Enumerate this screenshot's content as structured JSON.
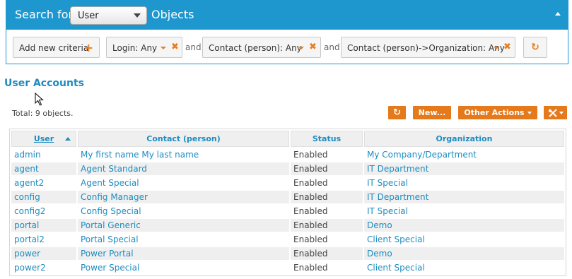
{
  "search": {
    "label_before": "Search for",
    "class_selected": "User",
    "label_after": "Objects",
    "add_criteria_label": "Add new criteria",
    "conjunction": "and",
    "criteria": [
      {
        "label": "Login: Any"
      },
      {
        "label": "Contact (person): Any"
      },
      {
        "label": "Contact (person)->Organization: Any"
      }
    ]
  },
  "results": {
    "title": "User Accounts",
    "total": "Total: 9 objects.",
    "actions": {
      "new_label": "New...",
      "other_label": "Other Actions"
    },
    "columns": [
      "User",
      "Contact (person)",
      "Status",
      "Organization"
    ],
    "rows": [
      [
        "admin",
        "My first name My last name",
        "Enabled",
        "My Company/Department"
      ],
      [
        "agent",
        "Agent Standard",
        "Enabled",
        "IT Department"
      ],
      [
        "agent2",
        "Agent Special",
        "Enabled",
        "IT Special"
      ],
      [
        "config",
        "Config Manager",
        "Enabled",
        "IT Department"
      ],
      [
        "config2",
        "Config Special",
        "Enabled",
        "IT Special"
      ],
      [
        "portal",
        "Portal Generic",
        "Enabled",
        "Demo"
      ],
      [
        "portal2",
        "Portal Special",
        "Enabled",
        "Client Special"
      ],
      [
        "power",
        "Power Portal",
        "Enabled",
        "Demo"
      ],
      [
        "power2",
        "Power Special",
        "Enabled",
        "Client Special"
      ]
    ]
  },
  "icons": {
    "refresh": "refresh-icon",
    "add": "plus-icon",
    "remove": "close-icon",
    "dropdown": "caret-down-icon",
    "tools": "tools-icon",
    "collapse": "caret-up-icon",
    "sort": "sort-asc-icon"
  },
  "colors": {
    "header_blue": "#1e97cf",
    "link_blue": "#1e8cc0",
    "accent_orange": "#e57a1d",
    "row_alt": "#efefef"
  }
}
